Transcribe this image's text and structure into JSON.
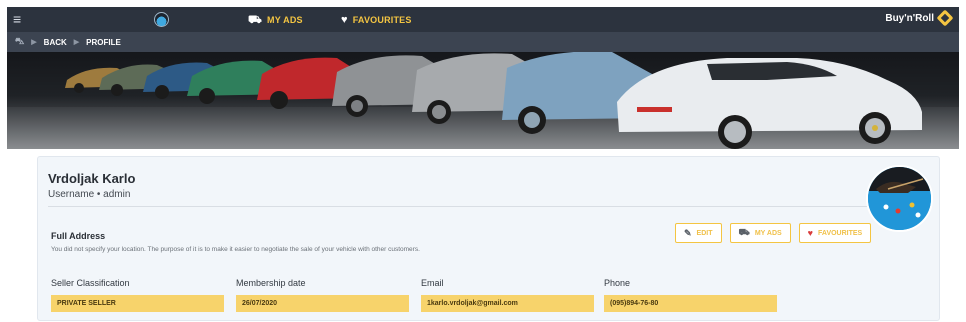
{
  "topbar": {
    "menu_icon": "hamburger-icon",
    "my_ads_label": "MY ADS",
    "my_ads_icon": "user-car-icon",
    "favourites_label": "FAVOURITES",
    "favourites_icon": "heart-icon",
    "brand": "Buy'n'Roll",
    "accent_color": "#f4c542"
  },
  "breadcrumb": {
    "home_icon": "car-icon",
    "items": [
      "BACK",
      "PROFILE"
    ]
  },
  "profile": {
    "name": "Vrdoljak Karlo",
    "username": "Username • admin",
    "address_label": "Full Address",
    "address_text": "You did not specify your location. The purpose of it is to make it easier to negotiate the sale of your vehicle with other customers.",
    "actions": [
      {
        "label": "EDIT",
        "icon": "user-edit-icon"
      },
      {
        "label": "MY ADS",
        "icon": "user-car-icon"
      },
      {
        "label": "FAVOURITES",
        "icon": "heart-icon"
      }
    ],
    "fields": [
      {
        "label": "Seller Classification",
        "value": "PRIVATE SELLER"
      },
      {
        "label": "Membership date",
        "value": "26/07/2020"
      },
      {
        "label": "Email",
        "value": "1karlo.vrdoljak@gmail.com"
      },
      {
        "label": "Phone",
        "value": "(095)894-76-80"
      }
    ]
  }
}
